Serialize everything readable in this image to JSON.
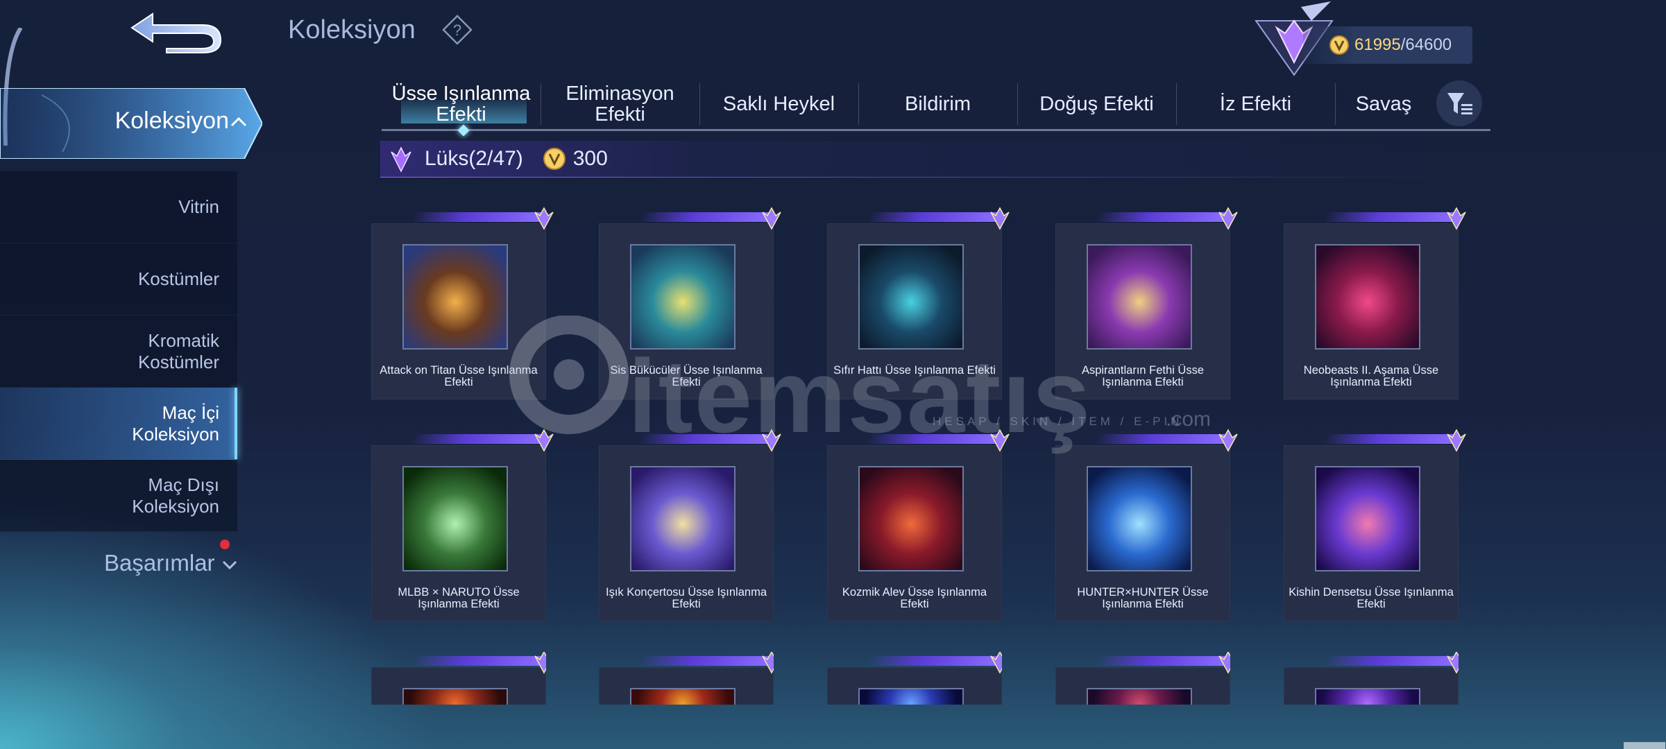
{
  "header": {
    "title": "Koleksiyon",
    "help_icon": "question-diamond-icon",
    "points_current": "61995",
    "points_max": "/64600",
    "colors": {
      "accent": "#7fd6ff",
      "gold": "#ffd97a",
      "purple": "#8a6cff"
    }
  },
  "sidebar": {
    "active_section": "Koleksiyon",
    "items": [
      {
        "lines": [
          "Vitrin"
        ]
      },
      {
        "lines": [
          "Kostümler"
        ]
      },
      {
        "lines": [
          "Kromatik",
          "Kostümler"
        ]
      },
      {
        "lines": [
          "Maç İçi",
          "Koleksiyon"
        ],
        "selected": true
      },
      {
        "lines": [
          "Maç Dışı",
          "Koleksiyon"
        ]
      }
    ],
    "achievements": "Başarımlar"
  },
  "tabs": [
    {
      "label": "Üsse Işınlanma Efekti",
      "l1": "Üsse Işınlanma",
      "l2": "Efekti",
      "active": true
    },
    {
      "label": "Eliminasyon Efekti",
      "l1": "Eliminasyon",
      "l2": "Efekti"
    },
    {
      "label": "Saklı Heykel",
      "l1": "Saklı Heykel",
      "l2": ""
    },
    {
      "label": "Bildirim",
      "l1": "Bildirim",
      "l2": ""
    },
    {
      "label": "Doğuş Efekti",
      "l1": "Doğuş Efekti",
      "l2": ""
    },
    {
      "label": "İz Efekti",
      "l1": "İz Efekti",
      "l2": ""
    },
    {
      "label": "Savaş",
      "l1": "Savaş",
      "l2": ""
    }
  ],
  "category": {
    "name": "Lüks",
    "count": "(2/47)",
    "points": "300"
  },
  "items": [
    {
      "name": "Attack on Titan Üsse Işınlanma Efekti",
      "theme": [
        "#f2b04a",
        "#6a3a20",
        "#2a3a7a"
      ]
    },
    {
      "name": "Sis Bükücüler Üsse Işınlanma Efekti",
      "theme": [
        "#e8e070",
        "#2a8a9a",
        "#1a3a5a"
      ]
    },
    {
      "name": "Sıfır Hattı Üsse Işınlanma Efekti",
      "theme": [
        "#4ad0e0",
        "#1a4a6a",
        "#0c1a2a"
      ]
    },
    {
      "name": "Aspirantların Fethi Üsse Işınlanma Efekti",
      "theme": [
        "#f0d080",
        "#8a3ab0",
        "#3a1a5a"
      ]
    },
    {
      "name": "Neobeasts II. Aşama Üsse Işınlanma Efekti",
      "theme": [
        "#f04a8a",
        "#8a1a4a",
        "#2a0a2a"
      ]
    },
    {
      "name": "MLBB × NARUTO Üsse Işınlanma Efekti",
      "theme": [
        "#b0f0b0",
        "#3a7a3a",
        "#0a2a0a"
      ]
    },
    {
      "name": "Işık Konçertosu Üsse Işınlanma Efekti",
      "theme": [
        "#f0e0a0",
        "#6a5ad0",
        "#2a1a6a"
      ]
    },
    {
      "name": "Kozmik Alev Üsse Işınlanma Efekti",
      "theme": [
        "#f06a3a",
        "#8a1a2a",
        "#2a0a1a"
      ]
    },
    {
      "name": "HUNTER×HUNTER Üsse Işınlanma Efekti",
      "theme": [
        "#a0e0ff",
        "#2a6ad0",
        "#0a1a4a"
      ]
    },
    {
      "name": "Kishin Densetsu Üsse Işınlanma Efekti",
      "theme": [
        "#f07ab0",
        "#6a3ad0",
        "#1a0a4a"
      ]
    },
    {
      "name": "",
      "theme": [
        "#f06a2a",
        "#8a2a1a",
        "#2a0a0a"
      ]
    },
    {
      "name": "",
      "theme": [
        "#f0a02a",
        "#a02a1a",
        "#3a0a0a"
      ]
    },
    {
      "name": "",
      "theme": [
        "#6aa0ff",
        "#2a3ab0",
        "#0a0a3a"
      ]
    },
    {
      "name": "",
      "theme": [
        "#d04a6a",
        "#6a1a4a",
        "#1a0a2a"
      ]
    },
    {
      "name": "",
      "theme": [
        "#b06aff",
        "#5a2ab0",
        "#1a0a4a"
      ]
    }
  ],
  "watermark": {
    "brand": "itemsatış",
    "tagline": "HESAP / SKIN / ITEM / E-PIN",
    "suffix": ".com"
  }
}
